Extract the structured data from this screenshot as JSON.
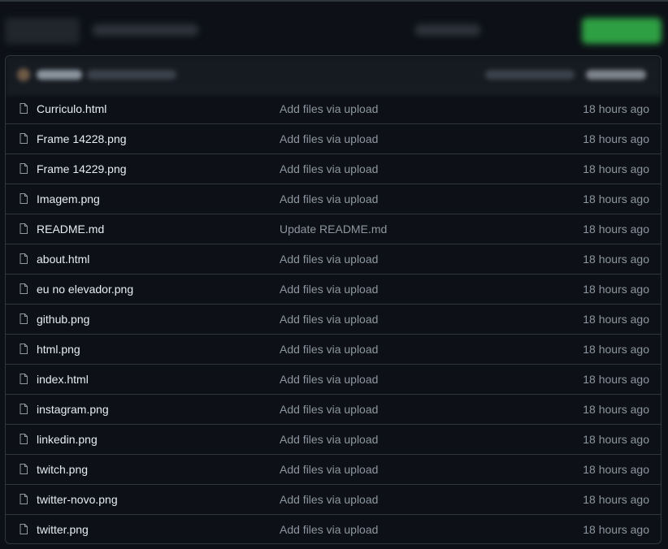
{
  "colors": {
    "background": "#0d1117",
    "header": "#161b22",
    "border": "#30363d",
    "accent_button": "#238636",
    "muted_text": "#8d96a0"
  },
  "files": [
    {
      "name": "Curriculo.html",
      "message": "Add files via upload",
      "time": "18 hours ago",
      "icon": "file-icon"
    },
    {
      "name": "Frame 14228.png",
      "message": "Add files via upload",
      "time": "18 hours ago",
      "icon": "file-icon"
    },
    {
      "name": "Frame 14229.png",
      "message": "Add files via upload",
      "time": "18 hours ago",
      "icon": "file-icon"
    },
    {
      "name": "Imagem.png",
      "message": "Add files via upload",
      "time": "18 hours ago",
      "icon": "file-icon"
    },
    {
      "name": "README.md",
      "message": "Update README.md",
      "time": "18 hours ago",
      "icon": "file-icon"
    },
    {
      "name": "about.html",
      "message": "Add files via upload",
      "time": "18 hours ago",
      "icon": "file-icon"
    },
    {
      "name": "eu no elevador.png",
      "message": "Add files via upload",
      "time": "18 hours ago",
      "icon": "file-icon"
    },
    {
      "name": "github.png",
      "message": "Add files via upload",
      "time": "18 hours ago",
      "icon": "file-icon"
    },
    {
      "name": "html.png",
      "message": "Add files via upload",
      "time": "18 hours ago",
      "icon": "file-icon"
    },
    {
      "name": "index.html",
      "message": "Add files via upload",
      "time": "18 hours ago",
      "icon": "file-icon"
    },
    {
      "name": "instagram.png",
      "message": "Add files via upload",
      "time": "18 hours ago",
      "icon": "file-icon"
    },
    {
      "name": "linkedin.png",
      "message": "Add files via upload",
      "time": "18 hours ago",
      "icon": "file-icon"
    },
    {
      "name": "twitch.png",
      "message": "Add files via upload",
      "time": "18 hours ago",
      "icon": "file-icon"
    },
    {
      "name": "twitter-novo.png",
      "message": "Add files via upload",
      "time": "18 hours ago",
      "icon": "file-icon"
    },
    {
      "name": "twitter.png",
      "message": "Add files via upload",
      "time": "18 hours ago",
      "icon": "file-icon"
    }
  ]
}
